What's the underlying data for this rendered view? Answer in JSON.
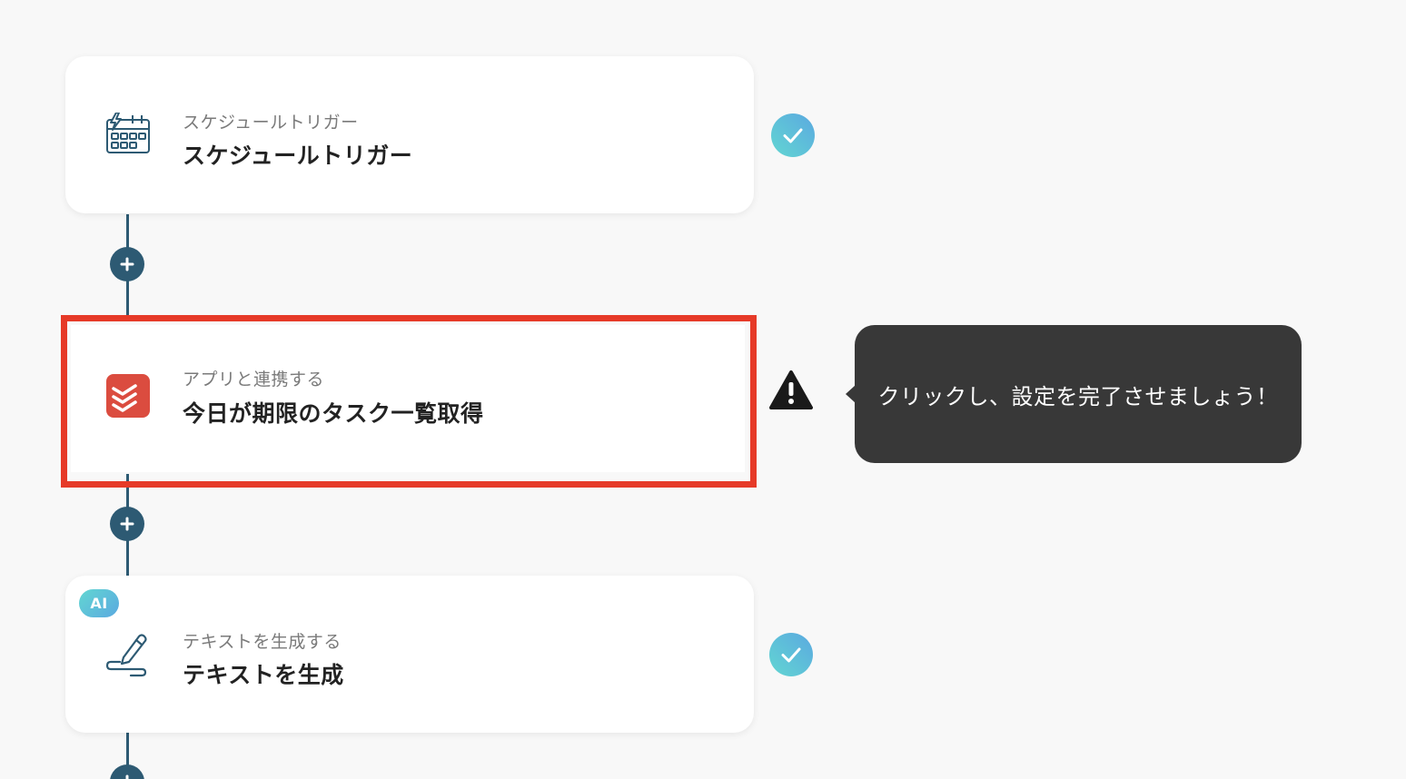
{
  "flow": {
    "steps": [
      {
        "subtitle": "スケジュールトリガー",
        "title": "スケジュールトリガー",
        "icon": "calendar-lightning-icon",
        "status": "completed"
      },
      {
        "subtitle": "アプリと連携する",
        "title": "今日が期限のタスク一覧取得",
        "icon": "todoist-icon",
        "status": "warning",
        "highlighted": true
      },
      {
        "badge": "AI",
        "subtitle": "テキストを生成する",
        "title": "テキストを生成",
        "icon": "pencil-scribble-icon",
        "status": "completed"
      }
    ]
  },
  "tooltip": {
    "text": "クリックし、設定を完了させましょう！"
  },
  "colors": {
    "connector": "#2d5a73",
    "highlight": "#e63a28",
    "check_gradient_start": "#62d6d2",
    "check_gradient_end": "#5ba9e0",
    "todoist_red": "#db4c3f",
    "tooltip_bg": "#383838"
  }
}
